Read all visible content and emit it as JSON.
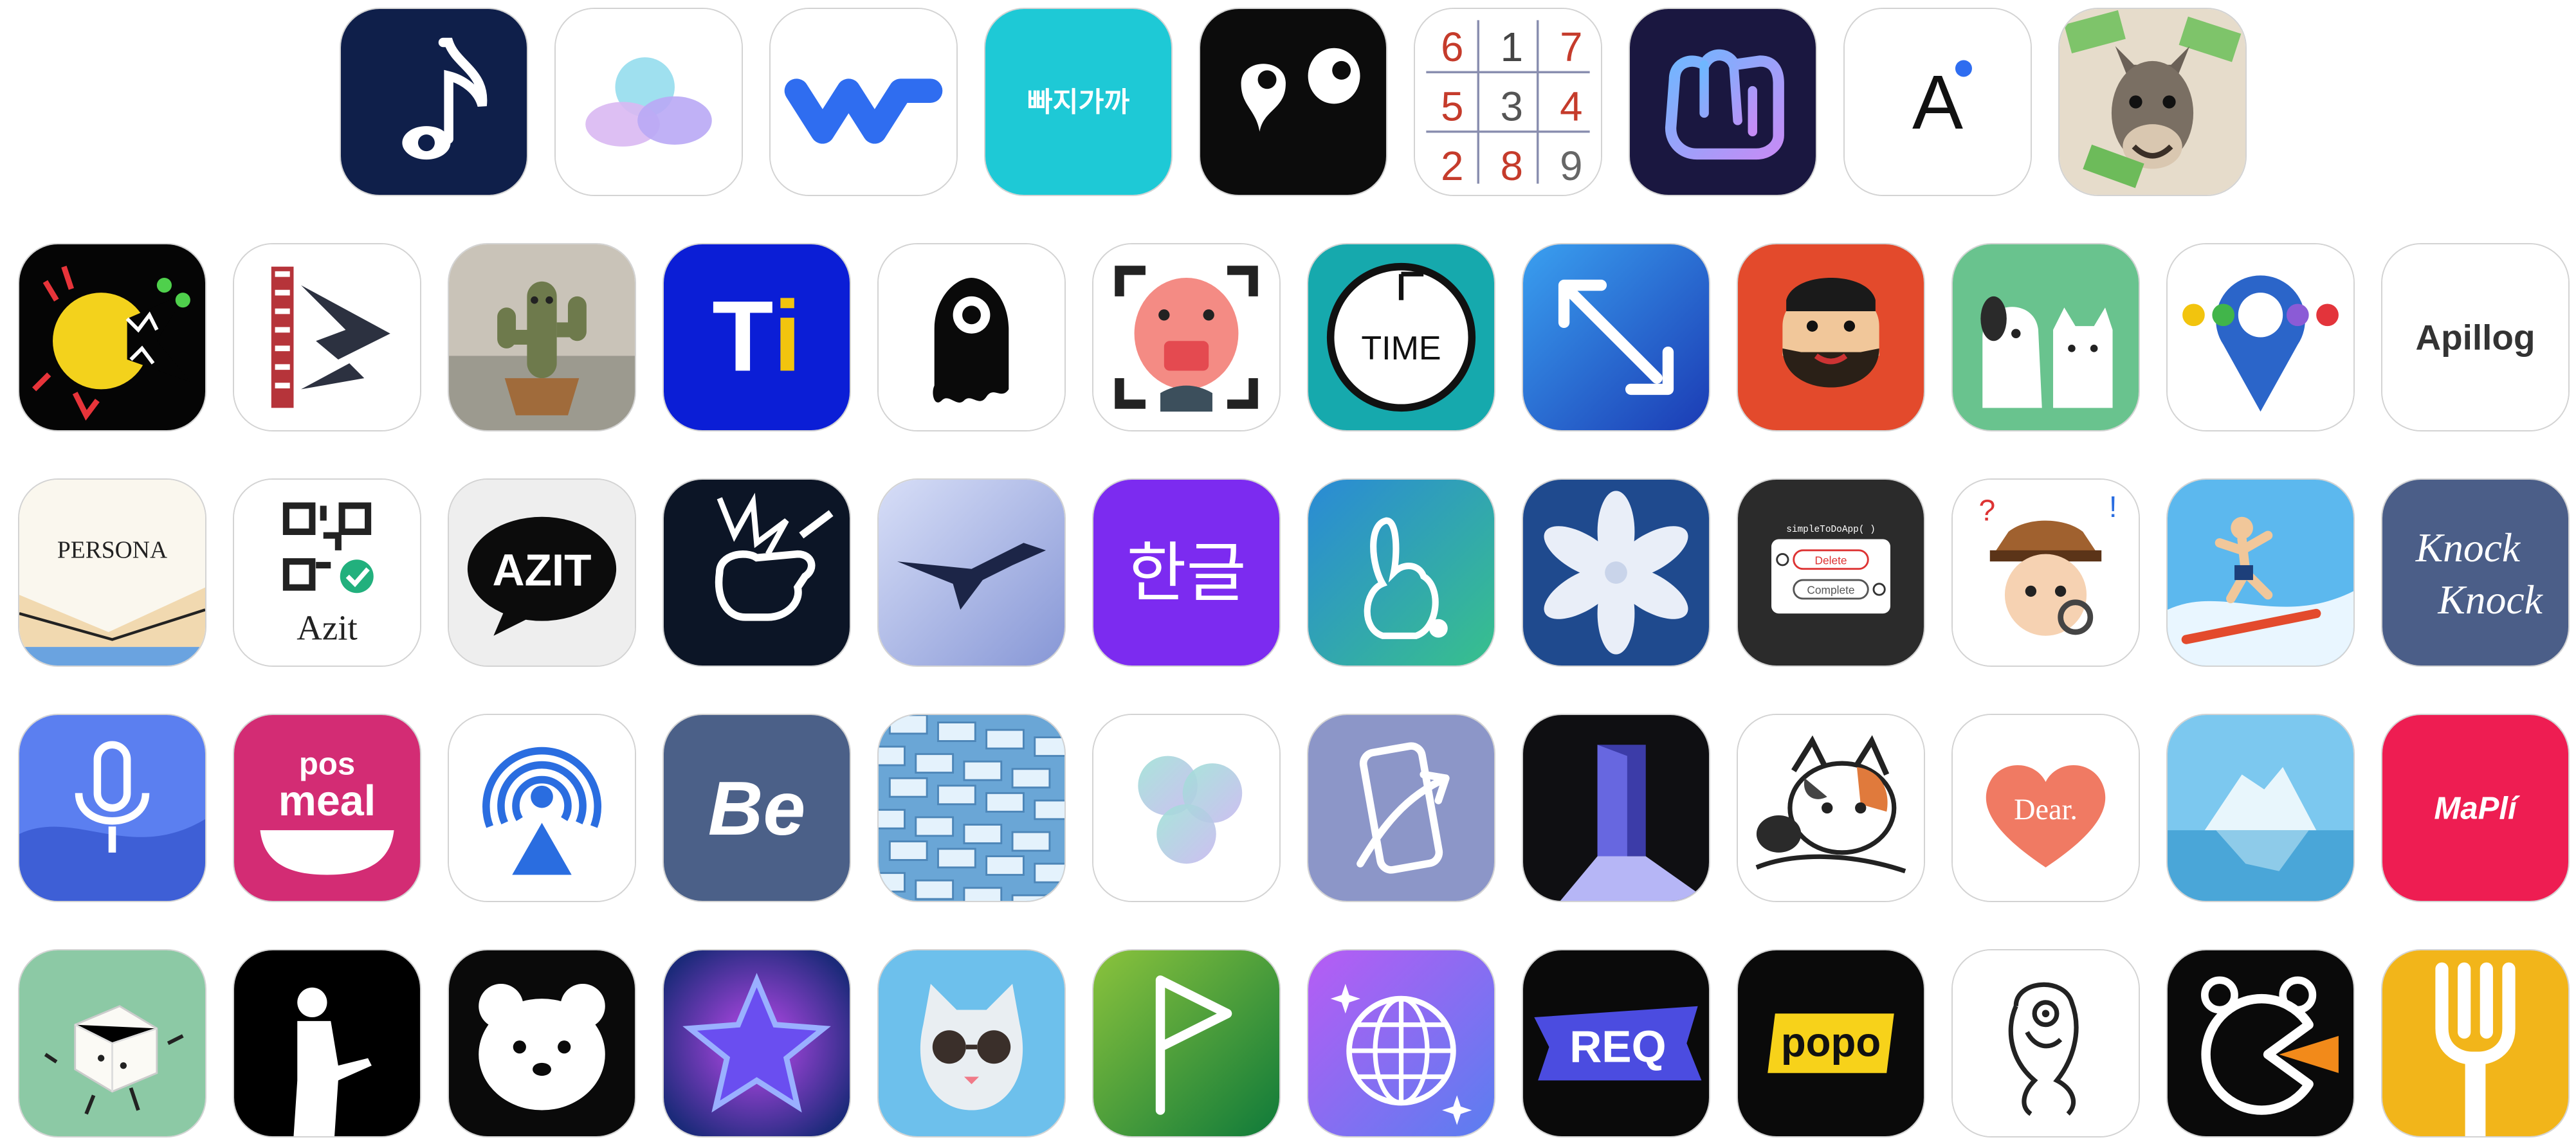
{
  "page": {
    "background": "#ffffff"
  },
  "rows": [
    {
      "name": "row-1",
      "icons": [
        {
          "id": "music-note-eye",
          "name": "music-note-eye-app-icon",
          "kind": "music",
          "bg": "#0f1f4a"
        },
        {
          "id": "pastel-blobs",
          "name": "pastel-blobs-app-icon",
          "kind": "blobs",
          "bg": "#ffffff"
        },
        {
          "id": "blue-w-wave",
          "name": "blue-w-wave-app-icon",
          "kind": "wave",
          "bg": "#ffffff",
          "accent": "#2f6df0"
        },
        {
          "id": "bbajigagga",
          "name": "bbajigagga-app-icon",
          "kind": "text",
          "bg": "#1ec9d6",
          "color": "#ffffff",
          "text": "빠지가까",
          "size": 44,
          "weight": "bold"
        },
        {
          "id": "ghost-eyes-black",
          "name": "black-eyes-face-app-icon",
          "kind": "eyes",
          "bg": "#0c0c0c"
        },
        {
          "id": "sudoku",
          "name": "sudoku-grid-app-icon",
          "kind": "sudoku",
          "bg": "#ffffff",
          "digits": [
            "6",
            "1",
            "7",
            "5",
            "3",
            "4",
            "2",
            "8",
            "9"
          ],
          "digit_colors": [
            "#c53b2b",
            "#444444",
            "#c53b2b",
            "#c53b2b",
            "#555555",
            "#c53b2b",
            "#c53b2b",
            "#c53b2b",
            "#666666"
          ]
        },
        {
          "id": "purple-fist",
          "name": "purple-fist-app-icon",
          "kind": "fist",
          "bg": "#1a1740"
        },
        {
          "id": "letter-a-dot",
          "name": "letter-a-dot-app-icon",
          "kind": "text",
          "bg": "#ffffff",
          "color": "#111111",
          "text": "A",
          "size": 120,
          "weight": "normal",
          "dot": "#2f6df0"
        },
        {
          "id": "donkey-money",
          "name": "donkey-money-app-icon",
          "kind": "donkey",
          "bg": "#e6dccb"
        }
      ]
    },
    {
      "name": "row-2",
      "icons": [
        {
          "id": "yellow-monster",
          "name": "yellow-monster-app-icon",
          "kind": "monster",
          "bg": "#050505"
        },
        {
          "id": "film-arrow",
          "name": "film-arrow-app-icon",
          "kind": "film",
          "bg": "#ffffff"
        },
        {
          "id": "dancing-cactus",
          "name": "dancing-cactus-app-icon",
          "kind": "cactus",
          "bg": "#c9c3b8"
        },
        {
          "id": "ti-logo",
          "name": "ti-logo-app-icon",
          "kind": "ti",
          "bg": "#0b1ed6",
          "text": "Ti"
        },
        {
          "id": "black-ghost-eye",
          "name": "black-ghost-eye-app-icon",
          "kind": "ghost",
          "bg": "#ffffff"
        },
        {
          "id": "pig-scan",
          "name": "pig-face-scan-app-icon",
          "kind": "pig",
          "bg": "#ffffff"
        },
        {
          "id": "time-clock",
          "name": "time-clock-app-icon",
          "kind": "clock",
          "bg": "#16a9ad",
          "text": "TIME"
        },
        {
          "id": "expand-arrows",
          "name": "expand-arrows-app-icon",
          "kind": "expand",
          "bg": "#1a6ee0"
        },
        {
          "id": "bearded-man",
          "name": "bearded-man-app-icon",
          "kind": "beard",
          "bg": "#e34a2c"
        },
        {
          "id": "dog-cat",
          "name": "dog-and-cat-app-icon",
          "kind": "dogcat",
          "bg": "#69c38e"
        },
        {
          "id": "map-pin-dots",
          "name": "map-pin-dots-app-icon",
          "kind": "pin",
          "bg": "#ffffff"
        },
        {
          "id": "apillog",
          "name": "apillog-app-icon",
          "kind": "text",
          "bg": "#ffffff",
          "color": "#333333",
          "text": "Apillog",
          "size": 56,
          "weight": "bold"
        }
      ]
    },
    {
      "name": "row-3",
      "icons": [
        {
          "id": "persona",
          "name": "persona-book-app-icon",
          "kind": "persona",
          "bg": "#faf7ee",
          "text": "PERSONA"
        },
        {
          "id": "azit-qr",
          "name": "azit-qr-app-icon",
          "kind": "qr",
          "bg": "#ffffff",
          "text": "Azit"
        },
        {
          "id": "azit-bubble",
          "name": "azit-speech-bubble-app-icon",
          "kind": "bubble",
          "bg": "#eeeeee",
          "text": "AZIT"
        },
        {
          "id": "fist-punch",
          "name": "fist-punch-app-icon",
          "kind": "punch",
          "bg": "#0c1526"
        },
        {
          "id": "pterodactyl",
          "name": "pterodactyl-app-icon",
          "kind": "ptero",
          "bg": "#b8c4ea"
        },
        {
          "id": "hangul",
          "name": "hangul-app-icon",
          "kind": "text",
          "bg": "#7c2bf0",
          "color": "#ffffff",
          "text": "한글",
          "size": 104,
          "weight": "normal"
        },
        {
          "id": "rabbit-outline",
          "name": "rabbit-outline-app-icon",
          "kind": "rabbit",
          "bg": "#2fa6bf"
        },
        {
          "id": "snowflake-flower",
          "name": "snowflake-flower-app-icon",
          "kind": "flower",
          "bg": "#1f4a8e"
        },
        {
          "id": "simple-todo",
          "name": "simple-todo-app-icon",
          "kind": "todo",
          "bg": "#2b2b2b",
          "title": "simpleToDoApp( )",
          "delete_label": "Delete",
          "complete_label": "Complete"
        },
        {
          "id": "detective-kid",
          "name": "detective-kid-app-icon",
          "kind": "detective",
          "bg": "#ffffff"
        },
        {
          "id": "surfer",
          "name": "surfer-app-icon",
          "kind": "surfer",
          "bg": "#5cb8ee"
        },
        {
          "id": "knock-knock",
          "name": "knock-knock-app-icon",
          "kind": "knock",
          "bg": "#4b5e88",
          "line1": "Knock",
          "line2": "Knock"
        }
      ]
    },
    {
      "name": "row-4",
      "icons": [
        {
          "id": "microphone-wave",
          "name": "microphone-wave-app-icon",
          "kind": "mic",
          "bg": "#5b7ff0"
        },
        {
          "id": "pos-meal",
          "name": "pos-meal-app-icon",
          "kind": "posmeal",
          "bg": "#d32c74",
          "line1": "pos",
          "line2": "meal"
        },
        {
          "id": "broadcast-person",
          "name": "broadcast-person-app-icon",
          "kind": "broadcast",
          "bg": "#ffffff"
        },
        {
          "id": "be-script",
          "name": "be-script-app-icon",
          "kind": "text",
          "bg": "#4b6088",
          "color": "#ffffff",
          "text": "Be",
          "size": 120,
          "weight": "bold",
          "italic": true
        },
        {
          "id": "blue-bricks",
          "name": "blue-bricks-app-icon",
          "kind": "bricks",
          "bg": "#6aa6d6"
        },
        {
          "id": "fidget-spinner",
          "name": "fidget-spinner-app-icon",
          "kind": "spinner",
          "bg": "#ffffff"
        },
        {
          "id": "phone-arrow",
          "name": "phone-arrow-app-icon",
          "kind": "phone",
          "bg": "#8c96c8"
        },
        {
          "id": "open-door",
          "name": "open-door-app-icon",
          "kind": "door",
          "bg": "#0f0f12"
        },
        {
          "id": "calico-cat-mask",
          "name": "calico-cat-mask-app-icon",
          "kind": "calico",
          "bg": "#ffffff"
        },
        {
          "id": "dear-heart",
          "name": "dear-heart-app-icon",
          "kind": "heart",
          "bg": "#ffffff",
          "text": "Dear."
        },
        {
          "id": "iceberg",
          "name": "iceberg-app-icon",
          "kind": "iceberg",
          "bg": "#7cc8ef"
        },
        {
          "id": "mapli",
          "name": "mapli-app-icon",
          "kind": "text",
          "bg": "#ee1d52",
          "color": "#ffffff",
          "text": "MaPlí",
          "size": 50,
          "weight": "bold",
          "italic": true
        }
      ]
    },
    {
      "name": "row-5",
      "icons": [
        {
          "id": "tofu-cube",
          "name": "tofu-cube-app-icon",
          "kind": "tofu",
          "bg": "#8cc9a5"
        },
        {
          "id": "silhouette-man",
          "name": "silhouette-man-app-icon",
          "kind": "silhouette",
          "bg": "#000000"
        },
        {
          "id": "bear-head",
          "name": "bear-head-app-icon",
          "kind": "bear",
          "bg": "#0a0a0a"
        },
        {
          "id": "glowing-star",
          "name": "glowing-star-app-icon",
          "kind": "star",
          "bg": "#1c2a7a"
        },
        {
          "id": "cat-sunglasses",
          "name": "cat-sunglasses-app-icon",
          "kind": "catglasses",
          "bg": "#6dc0ec"
        },
        {
          "id": "green-flag",
          "name": "green-flag-app-icon",
          "kind": "flag",
          "bg": "#2c9a3a"
        },
        {
          "id": "disco-ball",
          "name": "disco-ball-app-icon",
          "kind": "disco",
          "bg": "#8a4ef0"
        },
        {
          "id": "req-ribbon",
          "name": "req-ribbon-app-icon",
          "kind": "req",
          "bg": "#0a0a0a",
          "text": "REQ"
        },
        {
          "id": "popo",
          "name": "popo-app-icon",
          "kind": "popo",
          "bg": "#0a0a0a",
          "text": "popo"
        },
        {
          "id": "parrot-sketch",
          "name": "parrot-sketch-app-icon",
          "kind": "parrot",
          "bg": "#ffffff"
        },
        {
          "id": "pacman-bear",
          "name": "pacman-bear-app-icon",
          "kind": "pacman",
          "bg": "#0a0a0a"
        },
        {
          "id": "fork",
          "name": "fork-app-icon",
          "kind": "fork",
          "bg": "#f2b51a"
        }
      ]
    }
  ]
}
